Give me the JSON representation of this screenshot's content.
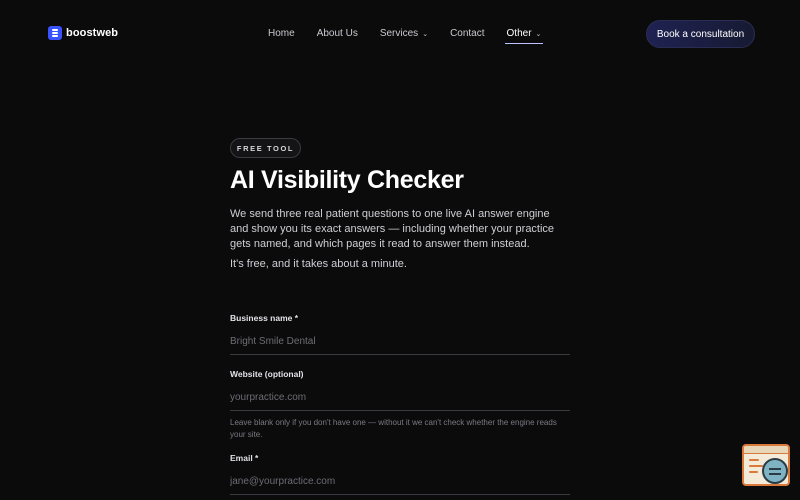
{
  "header": {
    "logo_text": "boostweb",
    "nav": [
      {
        "label": "Home",
        "has_dropdown": false
      },
      {
        "label": "About Us",
        "has_dropdown": false
      },
      {
        "label": "Services",
        "has_dropdown": true
      },
      {
        "label": "Contact",
        "has_dropdown": false
      },
      {
        "label": "Other",
        "has_dropdown": true,
        "active": true
      }
    ],
    "chevron": "⌄",
    "cta_label": "Book a consultation"
  },
  "hero": {
    "badge": "FREE TOOL",
    "title": "AI Visibility Checker",
    "description": "We send three real patient questions to one live AI answer engine and show you its exact answers — including whether your practice gets named, and which pages it read to answer them instead.",
    "subtext": "It's free, and it takes about a minute."
  },
  "form": {
    "business": {
      "label": "Business name *",
      "placeholder": "Bright Smile Dental",
      "value": ""
    },
    "website": {
      "label": "Website (optional)",
      "placeholder": "yourpractice.com",
      "value": "",
      "help": "Leave blank only if you don't have one — without it we can't check whether the engine reads your site."
    },
    "email": {
      "label": "Email *",
      "placeholder": "jane@yourpractice.com",
      "value": ""
    }
  },
  "colors": {
    "background": "#0b0b0c",
    "accent": "#3b52ff",
    "cta_bg": "#1f2252",
    "widget_border": "#d97a3c"
  }
}
